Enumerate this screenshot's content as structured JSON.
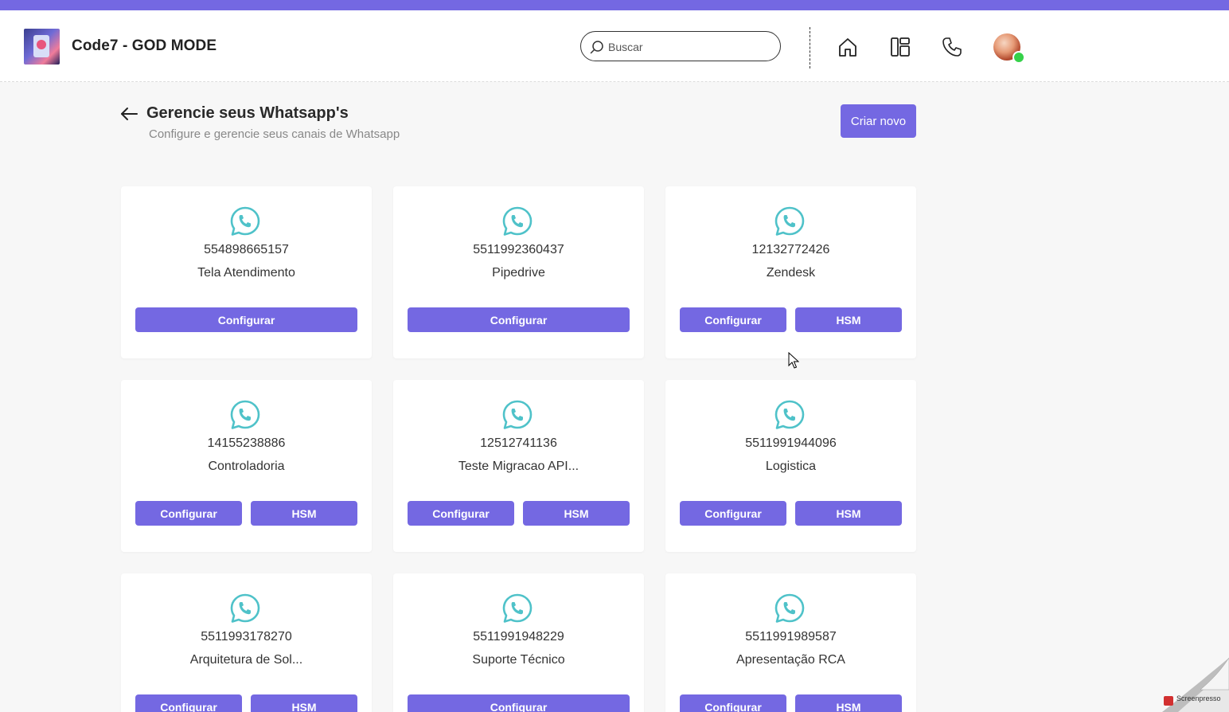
{
  "header": {
    "app_title": "Code7 - GOD MODE",
    "search_placeholder": "Buscar"
  },
  "page": {
    "title": "Gerencie seus Whatsapp's",
    "subtitle": "Configure e gerencie seus canais de Whatsapp",
    "create_label": "Criar novo"
  },
  "colors": {
    "accent": "#7468e2",
    "whatsapp_icon": "#4fc2c9",
    "status_online": "#36d14a"
  },
  "cards": [
    {
      "number": "554898665157",
      "name": "Tela Atendimento",
      "configure_label": "Configurar"
    },
    {
      "number": "5511992360437",
      "name": "Pipedrive",
      "configure_label": "Configurar"
    },
    {
      "number": "12132772426",
      "name": "Zendesk",
      "configure_label": "Configurar",
      "hsm_label": "HSM"
    },
    {
      "number": "14155238886",
      "name": "Controladoria",
      "configure_label": "Configurar",
      "hsm_label": "HSM"
    },
    {
      "number": "12512741136",
      "name": "Teste Migracao API...",
      "configure_label": "Configurar",
      "hsm_label": "HSM"
    },
    {
      "number": "5511991944096",
      "name": "Logistica",
      "configure_label": "Configurar",
      "hsm_label": "HSM"
    },
    {
      "number": "5511993178270",
      "name": "Arquitetura de Sol...",
      "configure_label": "Configurar",
      "hsm_label": "HSM"
    },
    {
      "number": "5511991948229",
      "name": "Suporte Técnico",
      "configure_label": "Configurar"
    },
    {
      "number": "5511991989587",
      "name": "Apresentação RCA",
      "configure_label": "Configurar",
      "hsm_label": "HSM"
    }
  ],
  "watermark": "Screenpresso"
}
